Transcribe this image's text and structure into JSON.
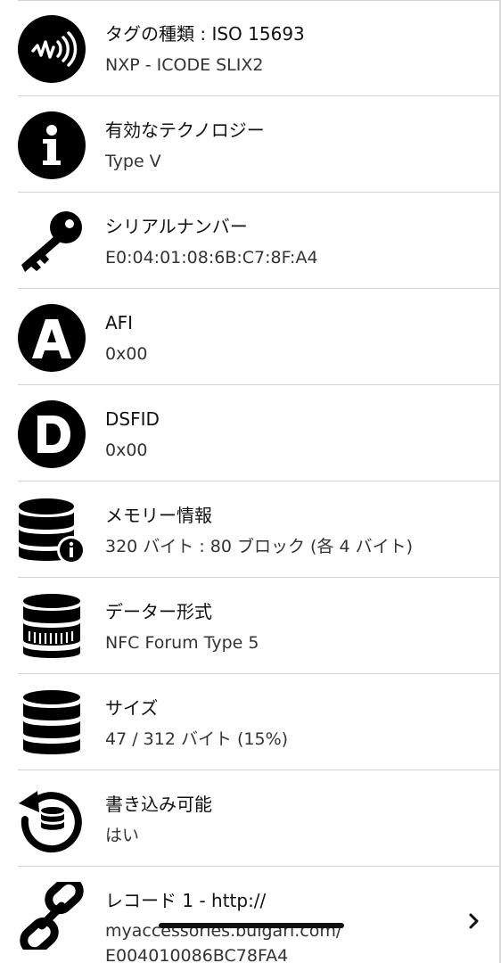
{
  "rows": [
    {
      "label": "タグの種類 : ISO 15693",
      "value": "NXP - ICODE SLIX2",
      "icon": "nfc-tag-icon"
    },
    {
      "label": "有効なテクノロジー",
      "value": "Type V",
      "icon": "info-icon"
    },
    {
      "label": "シリアルナンバー",
      "value": "E0:04:01:08:6B:C7:8F:A4",
      "icon": "key-icon"
    },
    {
      "label": "AFI",
      "value": "0x00",
      "icon": "letter-a-icon"
    },
    {
      "label": "DSFID",
      "value": "0x00",
      "icon": "letter-d-icon"
    },
    {
      "label": "メモリー情報",
      "value": "320 バイト : 80 ブロック (各 4 バイト)",
      "icon": "database-info-icon"
    },
    {
      "label": "データー形式",
      "value": "NFC Forum Type 5",
      "icon": "database-format-icon"
    },
    {
      "label": "サイズ",
      "value": "47 / 312 バイト (15%)",
      "icon": "database-size-icon"
    },
    {
      "label": "書き込み可能",
      "value": "はい",
      "icon": "writable-refresh-icon"
    },
    {
      "label": "レコード 1 - http://",
      "value_lines": [
        "myaccessories.bulgari.com/",
        "E004010086BC78FA4"
      ],
      "icon": "link-icon"
    }
  ],
  "colors": {
    "icon": "#000000",
    "separator": "#d4d4d4",
    "text_primary": "#111111",
    "text_secondary": "#333333"
  }
}
